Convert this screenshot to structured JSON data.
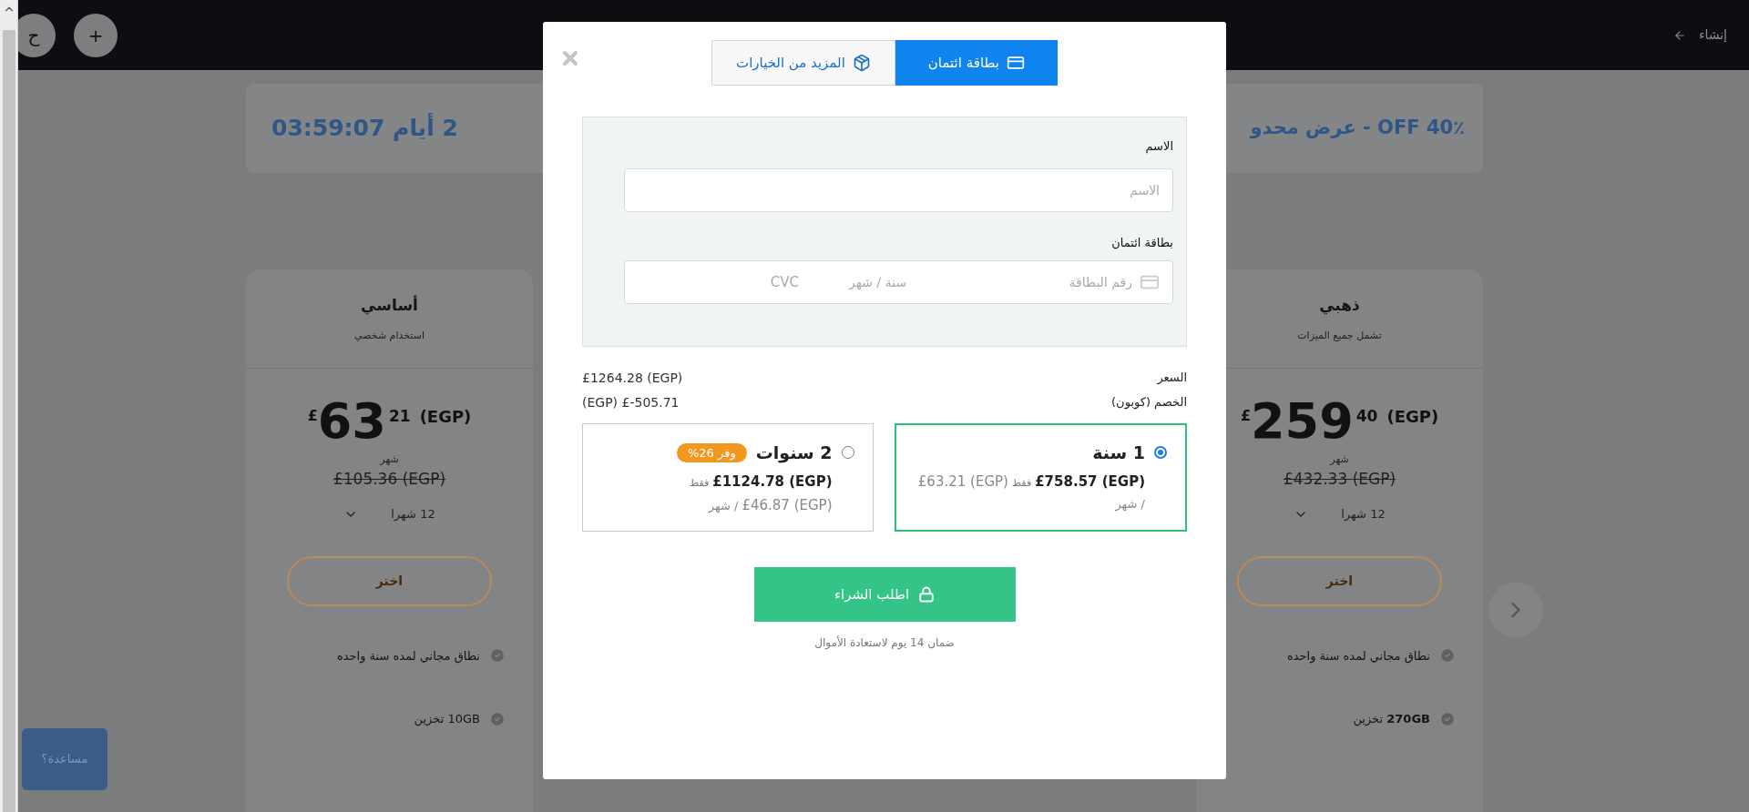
{
  "header": {
    "circle_buttons": [
      "+",
      "ح"
    ],
    "create_link": "إنشاء"
  },
  "banner": {
    "timer": "2 أيام 03:59:07",
    "offer": "عرض محدو - OFF 40٪"
  },
  "plans": [
    {
      "title": "ذهبي",
      "subtitle": "تشمل جميع الميزات",
      "currency": "£",
      "whole": "259",
      "cents": "40",
      "unit": "(EGP)",
      "period": "شهر",
      "old_price": "£432.33 (EGP)",
      "duration": "12 شهرا",
      "choose": "اختر",
      "features": [
        "نطاق مجاني لمده سنة واحده",
        "**270GB** تخزين"
      ]
    },
    {
      "title": "أساسي",
      "subtitle": "استخدام شخصي",
      "currency": "£",
      "whole": "63",
      "cents": "21",
      "unit": "(EGP)",
      "period": "شهر",
      "old_price": "£105.36 (EGP)",
      "duration": "12 شهرا",
      "choose": "اختر",
      "features": [
        "نطاق مجاني لمده سنة واحده",
        "10GB تخزين"
      ]
    }
  ],
  "help_button": "مساعدة؟",
  "modal": {
    "tabs": [
      {
        "label": "بطاقة ائتمان",
        "selected": true
      },
      {
        "label": "المزيد من الخيارات",
        "selected": false
      }
    ],
    "name_label": "الاسم",
    "name_placeholder": "الاسم",
    "card_label": "بطاقة ائتمان",
    "card_number_placeholder": "رقم البطاقة",
    "expiry_placeholder": "سنة / شهر",
    "cvc_placeholder": "CVC",
    "summary": [
      {
        "label": "السعر",
        "value": "£1264.28 (EGP)"
      },
      {
        "label": "الخصم (كوبون)",
        "value": "(EGP) £-505.71"
      }
    ],
    "options": [
      {
        "title": "1 سنة",
        "selected": true,
        "lines": [
          [
            {
              "kind": "total",
              "text": "£758.57 (EGP)"
            },
            {
              "kind": "note",
              "text": "فقط"
            },
            {
              "kind": "price",
              "text": "£63.21 (EGP)"
            }
          ],
          [
            {
              "kind": "text",
              "text": "/ شهر"
            }
          ]
        ]
      },
      {
        "title": "2 سنوات",
        "selected": false,
        "badge": "وفر 26%",
        "lines": [
          [
            {
              "kind": "total",
              "text": "£1124.78 (EGP)"
            },
            {
              "kind": "note",
              "text": "فقط"
            }
          ],
          [
            {
              "kind": "price",
              "text": "£46.87 (EGP)"
            },
            {
              "kind": "text",
              "text": "/ شهر"
            }
          ]
        ]
      }
    ],
    "buy_button": "اطلب الشراء",
    "guarantee": "ضمان 14 يوم لاستعادة الأموال"
  }
}
